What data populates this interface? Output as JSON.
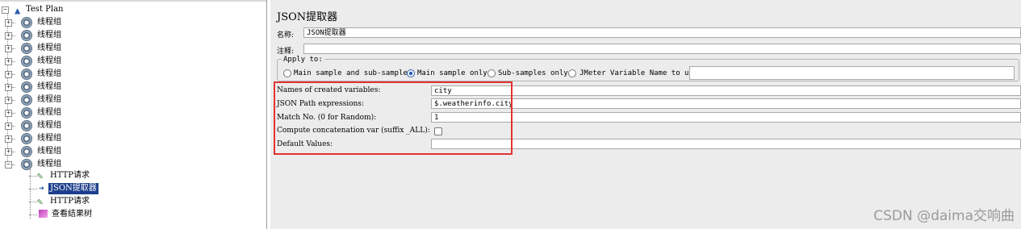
{
  "tree": {
    "root_label": "Test Plan",
    "thread_groups": [
      "线程组",
      "线程组",
      "线程组",
      "线程组",
      "线程组",
      "线程组",
      "线程组",
      "线程组",
      "线程组",
      "线程组",
      "线程组",
      "线程组"
    ],
    "children": [
      {
        "label": "HTTP请求",
        "icon": "pipette-icon",
        "selected": false
      },
      {
        "label": "JSON提取器",
        "icon": "extractor-icon",
        "selected": true
      },
      {
        "label": "HTTP请求",
        "icon": "pipette-icon",
        "selected": false
      },
      {
        "label": "查看结果树",
        "icon": "results-tree-icon",
        "selected": false
      }
    ]
  },
  "panel": {
    "title": "JSON提取器",
    "name_label": "名称:",
    "name_value": "JSON提取器",
    "comment_label": "注释:",
    "comment_value": "",
    "apply_to": {
      "legend": "Apply to:",
      "options": [
        "Main sample and sub-samples",
        "Main sample only",
        "Sub-samples only",
        "JMeter Variable Name to use"
      ],
      "selected_index": 1,
      "variable_name_value": ""
    },
    "fields": {
      "names_label": "Names of created variables:",
      "names_value": "city",
      "path_label": "JSON Path expressions:",
      "path_value": "$.weatherinfo.city",
      "match_label": "Match No. (0 for Random):",
      "match_value": "1",
      "concat_label": "Compute concatenation var (suffix _ALL):",
      "concat_checked": false,
      "default_label": "Default Values:",
      "default_value": ""
    }
  },
  "watermark": "CSDN @daima交响曲",
  "colors": {
    "selection": "#1c3e8c",
    "highlight_box": "#e23232",
    "panel_bg": "#ececec"
  }
}
